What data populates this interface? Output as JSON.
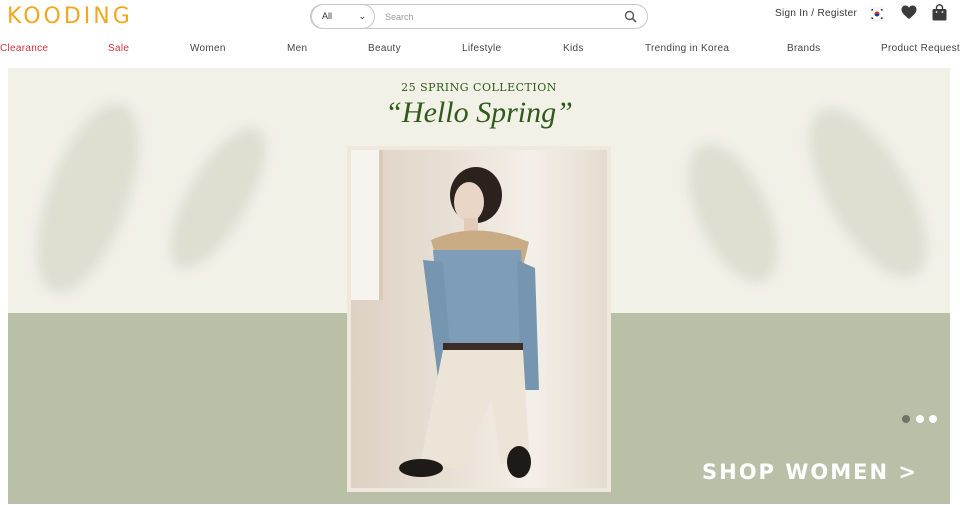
{
  "header": {
    "logo": "KOODING",
    "search": {
      "category_value": "All",
      "placeholder": "Search"
    },
    "signin_label": "Sign In / Register",
    "icons": [
      "korea-flag-icon",
      "heart-icon",
      "shopping-bag-icon",
      "search-icon",
      "chevron-down-icon"
    ]
  },
  "nav": {
    "items": [
      {
        "label": "Clearance"
      },
      {
        "label": "Sale"
      },
      {
        "label": "Women"
      },
      {
        "label": "Men"
      },
      {
        "label": "Beauty"
      },
      {
        "label": "Lifestyle"
      },
      {
        "label": "Kids"
      },
      {
        "label": "Trending in Korea"
      },
      {
        "label": "Brands"
      },
      {
        "label": "Product Request"
      }
    ]
  },
  "banner": {
    "eyebrow": "25 SPRING COLLECTION",
    "headline": "“Hello Spring”",
    "cta": "SHOP WOMEN >",
    "slide_count": 3,
    "active_slide": 1
  },
  "colors": {
    "brand": "#f0a91e",
    "sale_red": "#d2323e",
    "headline_green": "#2f5a1a",
    "banner_top": "#f2f1e8",
    "banner_bottom": "#babfa8"
  }
}
